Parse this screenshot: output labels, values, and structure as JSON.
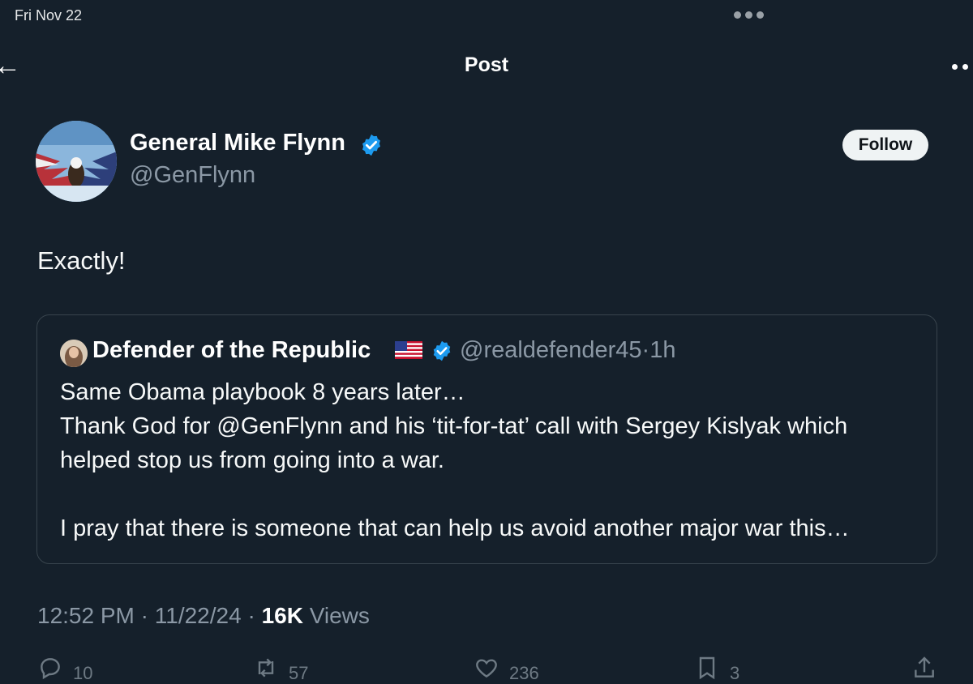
{
  "status_bar": {
    "date": "Fri Nov 22"
  },
  "header": {
    "title": "Post"
  },
  "author": {
    "name": "General Mike Flynn",
    "handle": "@GenFlynn",
    "follow_label": "Follow"
  },
  "post": {
    "text": "Exactly!"
  },
  "quoted": {
    "name": "Defender of the Republic",
    "flag": "🇺🇸",
    "handle": "@realdefender45",
    "time": "1h",
    "lines": [
      "Same Obama playbook 8 years later…",
      "Thank God for @GenFlynn and his ‘tit-for-tat’ call with Sergey Kislyak which",
      "helped stop us from going into a war.",
      "",
      "I pray that there is someone that can help us avoid another major war this…"
    ]
  },
  "meta": {
    "time": "12:52 PM",
    "date": "11/22/24",
    "views_count": "16K",
    "views_label": "Views"
  },
  "actions": {
    "replies": "10",
    "reposts": "57",
    "likes": "236",
    "bookmarks": "3"
  },
  "colors": {
    "background": "#15202b",
    "verified": "#1d9bf0",
    "muted": "#8b98a5"
  },
  "icons": [
    "back-arrow-icon",
    "more-icon",
    "verified-icon",
    "reply-icon",
    "repost-icon",
    "like-icon",
    "bookmark-icon",
    "share-icon"
  ]
}
